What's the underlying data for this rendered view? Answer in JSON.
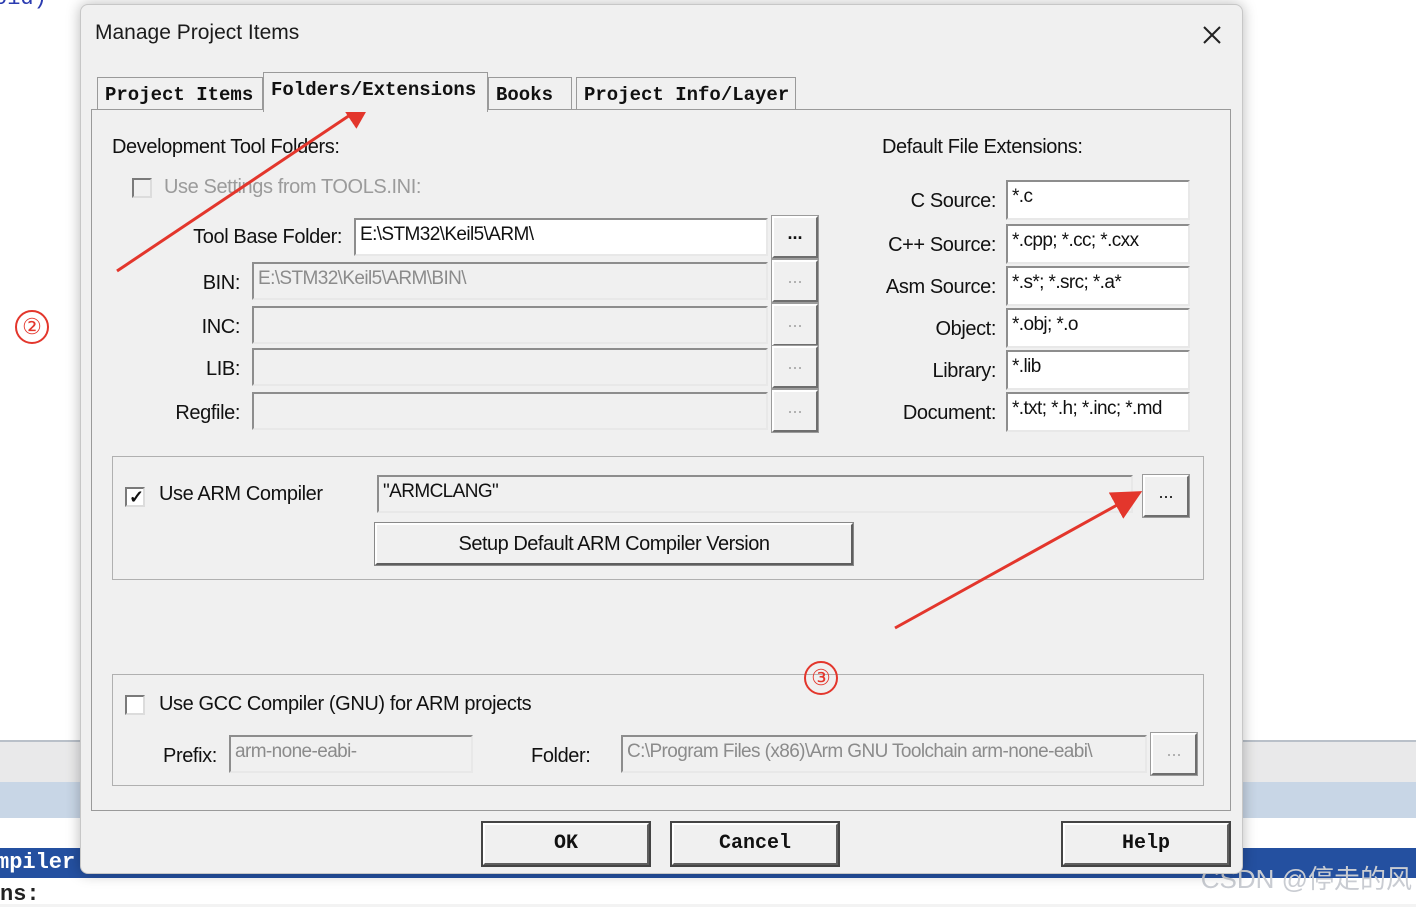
{
  "background": {
    "code_top": "oid)",
    "compiler_fragment": "mpiler",
    "ns_fragment": "ns:",
    "watermark": "CSDN @停走的风"
  },
  "dialog": {
    "title": "Manage Project Items",
    "close_icon": "close-icon"
  },
  "tabs": [
    {
      "label": "Project Items",
      "active": false
    },
    {
      "label": "Folders/Extensions",
      "active": true
    },
    {
      "label": "Books",
      "active": false
    },
    {
      "label": "Project Info/Layer",
      "active": false
    }
  ],
  "tool_folders": {
    "heading": "Development Tool Folders:",
    "use_settings_label": "Use Settings from TOOLS.INI:",
    "use_settings_checked": false,
    "use_settings_enabled": false,
    "rows": [
      {
        "label": "Tool Base Folder:",
        "value": "E:\\STM32\\Keil5\\ARM\\",
        "enabled": true
      },
      {
        "label": "BIN:",
        "value": "E:\\STM32\\Keil5\\ARM\\BIN\\",
        "enabled": false
      },
      {
        "label": "INC:",
        "value": "",
        "enabled": false
      },
      {
        "label": "LIB:",
        "value": "",
        "enabled": false
      },
      {
        "label": "Regfile:",
        "value": "",
        "enabled": false
      }
    ],
    "browse_label": "..."
  },
  "extensions": {
    "heading": "Default File Extensions:",
    "rows": [
      {
        "label": "C Source:",
        "value": "*.c"
      },
      {
        "label": "C++ Source:",
        "value": "*.cpp; *.cc; *.cxx"
      },
      {
        "label": "Asm Source:",
        "value": "*.s*; *.src; *.a*"
      },
      {
        "label": "Object:",
        "value": "*.obj; *.o"
      },
      {
        "label": "Library:",
        "value": "*.lib"
      },
      {
        "label": "Document:",
        "value": "*.txt; *.h; *.inc; *.md"
      }
    ]
  },
  "arm_compiler": {
    "checkbox_label": "Use ARM Compiler",
    "checked": true,
    "value": "\"ARMCLANG\"",
    "browse_label": "...",
    "setup_button": "Setup Default ARM Compiler Version"
  },
  "gcc_compiler": {
    "checkbox_label": "Use GCC Compiler (GNU) for ARM projects",
    "checked": false,
    "prefix_label": "Prefix:",
    "prefix_value": "arm-none-eabi-",
    "folder_label": "Folder:",
    "folder_value": "C:\\Program Files (x86)\\Arm GNU Toolchain arm-none-eabi\\",
    "browse_label": "..."
  },
  "buttons": {
    "ok": "OK",
    "cancel": "Cancel",
    "help": "Help"
  },
  "annotations": {
    "marker_2": "②",
    "marker_3": "③",
    "arrow_color": "#e3362c"
  }
}
